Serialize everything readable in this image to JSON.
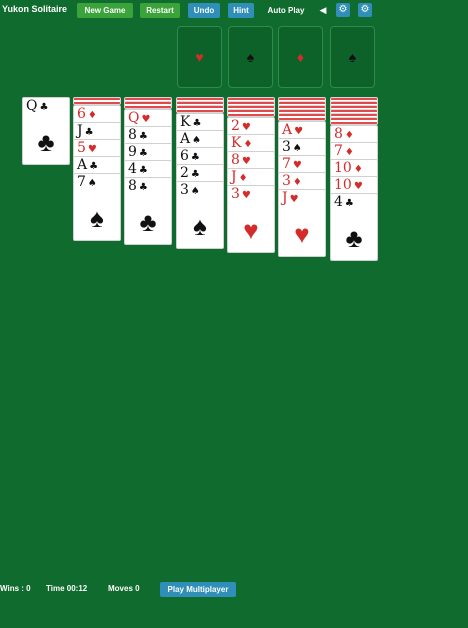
{
  "header": {
    "title": "Yukon Solitaire",
    "buttons": {
      "new_game": "New Game",
      "restart": "Restart",
      "undo": "Undo",
      "hint": "Hint",
      "auto_play": "Auto Play"
    },
    "icons": [
      "back-arrow-icon",
      "gear-icon",
      "settings-icon"
    ]
  },
  "foundations": [
    {
      "suit": "♥",
      "color": "red"
    },
    {
      "suit": "♠",
      "color": "black"
    },
    {
      "suit": "♦",
      "color": "red"
    },
    {
      "suit": "♠",
      "color": "black"
    }
  ],
  "tableau": [
    {
      "hidden": 0,
      "faceup": [
        {
          "rank": "Q",
          "suit": "♣",
          "color": "black"
        }
      ]
    },
    {
      "hidden": 1,
      "faceup": [
        {
          "rank": "6",
          "suit": "♦",
          "color": "red"
        },
        {
          "rank": "J",
          "suit": "♣",
          "color": "black"
        },
        {
          "rank": "5",
          "suit": "♥",
          "color": "red"
        },
        {
          "rank": "A",
          "suit": "♣",
          "color": "black"
        },
        {
          "rank": "7",
          "suit": "♠",
          "color": "black"
        }
      ]
    },
    {
      "hidden": 2,
      "faceup": [
        {
          "rank": "Q",
          "suit": "♥",
          "color": "red"
        },
        {
          "rank": "8",
          "suit": "♣",
          "color": "black"
        },
        {
          "rank": "9",
          "suit": "♣",
          "color": "black"
        },
        {
          "rank": "4",
          "suit": "♣",
          "color": "black"
        },
        {
          "rank": "8",
          "suit": "♣",
          "color": "black"
        }
      ]
    },
    {
      "hidden": 3,
      "faceup": [
        {
          "rank": "K",
          "suit": "♣",
          "color": "black"
        },
        {
          "rank": "A",
          "suit": "♠",
          "color": "black"
        },
        {
          "rank": "6",
          "suit": "♣",
          "color": "black"
        },
        {
          "rank": "2",
          "suit": "♣",
          "color": "black"
        },
        {
          "rank": "3",
          "suit": "♠",
          "color": "black"
        }
      ]
    },
    {
      "hidden": 4,
      "faceup": [
        {
          "rank": "2",
          "suit": "♥",
          "color": "red"
        },
        {
          "rank": "K",
          "suit": "♦",
          "color": "red"
        },
        {
          "rank": "8",
          "suit": "♥",
          "color": "red"
        },
        {
          "rank": "J",
          "suit": "♦",
          "color": "red"
        },
        {
          "rank": "3",
          "suit": "♥",
          "color": "red"
        }
      ]
    },
    {
      "hidden": 5,
      "faceup": [
        {
          "rank": "A",
          "suit": "♥",
          "color": "red"
        },
        {
          "rank": "3",
          "suit": "♠",
          "color": "black"
        },
        {
          "rank": "7",
          "suit": "♥",
          "color": "red"
        },
        {
          "rank": "3",
          "suit": "♦",
          "color": "red"
        },
        {
          "rank": "J",
          "suit": "♥",
          "color": "red"
        }
      ]
    },
    {
      "hidden": 6,
      "faceup": [
        {
          "rank": "8",
          "suit": "♦",
          "color": "red"
        },
        {
          "rank": "7",
          "suit": "♦",
          "color": "red"
        },
        {
          "rank": "10",
          "suit": "♦",
          "color": "red"
        },
        {
          "rank": "10",
          "suit": "♥",
          "color": "red"
        },
        {
          "rank": "4",
          "suit": "♣",
          "color": "black"
        }
      ]
    }
  ],
  "status": {
    "wins": "Wins : 0",
    "time": "Time 00:12",
    "moves": "Moves 0",
    "play_multiplayer": "Play Multiplayer"
  },
  "colors": {
    "felt": "#0f6b2e",
    "green_button": "#3aa43a",
    "blue_button": "#2f8fb8",
    "red_suit": "#d42b2b"
  }
}
